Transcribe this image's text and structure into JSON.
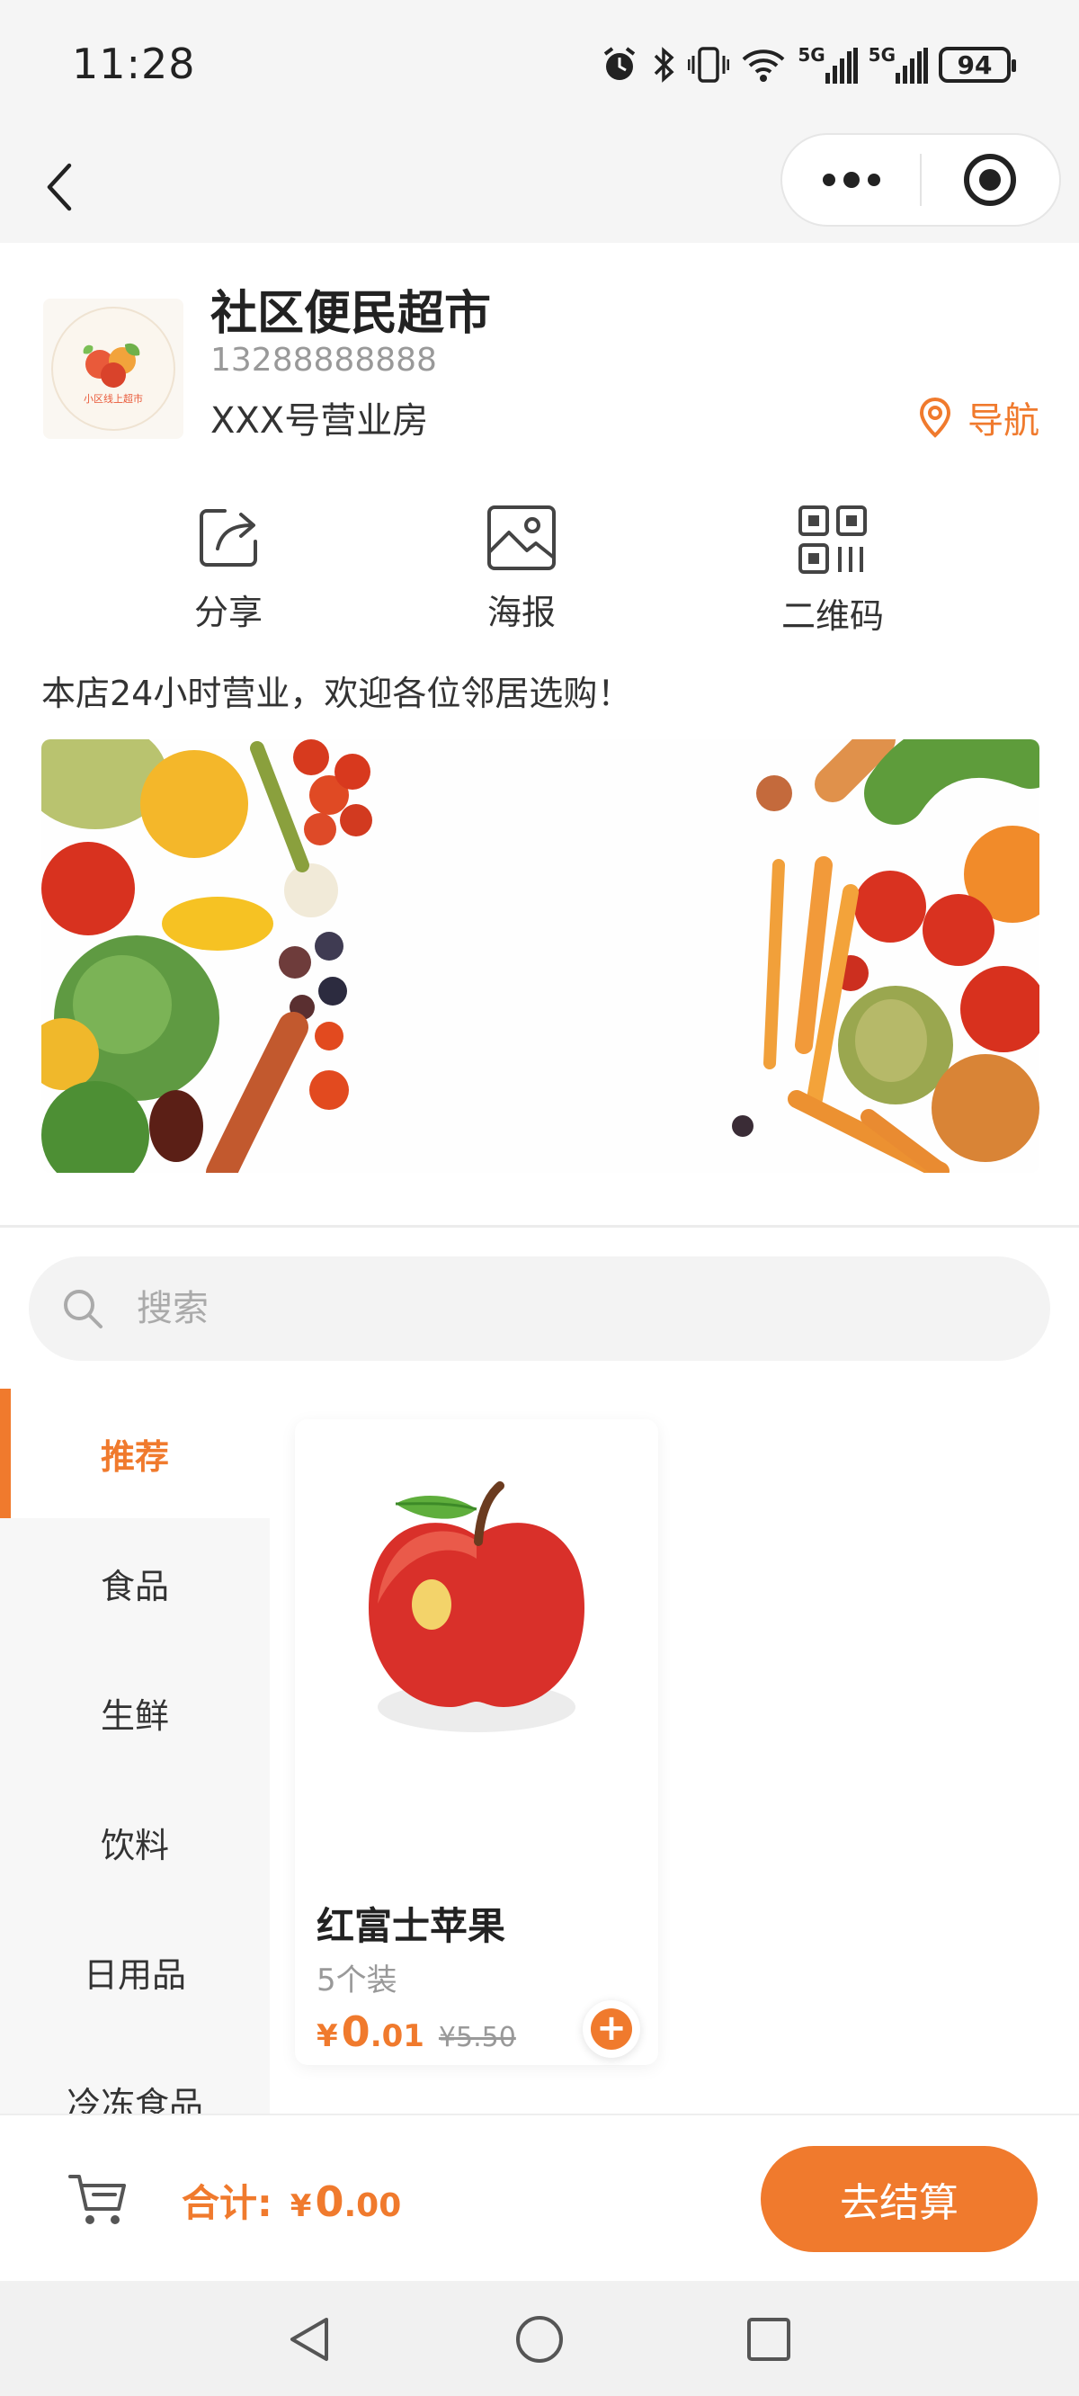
{
  "status_bar": {
    "time": "11:28",
    "battery": "94",
    "signal_1": "5G",
    "signal_2": "5G"
  },
  "shop": {
    "name": "社区便民超市",
    "phone": "13288888888",
    "address": "XXX号营业房",
    "nav_label": "导航",
    "logo_text": "小区线上超市"
  },
  "actions": [
    {
      "label": "分享",
      "icon": "share-icon"
    },
    {
      "label": "海报",
      "icon": "poster-image-icon"
    },
    {
      "label": "二维码",
      "icon": "qrcode-icon"
    }
  ],
  "notice": "本店24小时营业，欢迎各位邻居选购！",
  "search": {
    "placeholder": "搜索"
  },
  "categories": [
    {
      "label": "推荐",
      "active": true
    },
    {
      "label": "食品"
    },
    {
      "label": "生鲜"
    },
    {
      "label": "饮料"
    },
    {
      "label": "日用品"
    },
    {
      "label": "冷冻食品"
    }
  ],
  "products": [
    {
      "name": "红富士苹果",
      "spec": "5个装",
      "price_symbol": "¥",
      "price_int": "0",
      "price_dec": ".01",
      "original_price": "¥5.50"
    }
  ],
  "cart": {
    "total_label": "合计:",
    "symbol": "¥",
    "total_int": "0",
    "total_dec": ".00",
    "checkout_label": "去结算"
  },
  "colors": {
    "accent": "#f07a2d",
    "text": "#222222",
    "muted": "#999999"
  }
}
